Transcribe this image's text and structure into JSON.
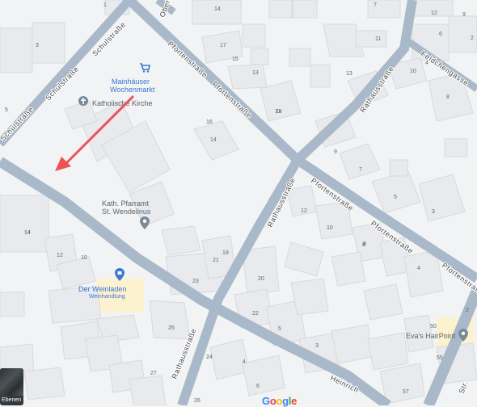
{
  "streets": {
    "schulstrasse_a": "Schulstraße",
    "schulstrasse_b": "Schulstraße",
    "schulstrasse_c": "Schulstraße",
    "pfortenstrasse_a": "Pfortenstraße",
    "pfortenstrasse_b": "Pfortenstraße",
    "pfortenstrasse_c": "Pfortenstraße",
    "pfortenstrasse_d": "Pfortenstraße",
    "pfortenstrasse_e": "Pfortenstraße",
    "pfortenstrasse_f": "Pfortenstraße",
    "rathausstrasse_a": "Rathausstraße",
    "rathausstrasse_b": "Rathausstraße",
    "rathausstrasse_c": "Rathausstraße",
    "feldchengasse": "Feldchengasse",
    "obertor": "Oberto",
    "heinrich": "Heinrich",
    "str_bottom_right": "Str."
  },
  "pois": {
    "mainhaeuser": {
      "line1": "Mainhäuser",
      "line2": "Wochenmarkt",
      "icon": "shopping-cart-icon"
    },
    "kirche": {
      "label": "Katholische Kirche",
      "icon": "cross-icon"
    },
    "pfarramt": {
      "line1": "Kath. Pfarramt",
      "line2": "St. Wendelinus",
      "icon": "place-pin-icon"
    },
    "weinladen": {
      "line1": "Der Weinladen",
      "line2": "Weinhandlung",
      "icon": "shopping-bag-icon"
    },
    "hairpoint": {
      "label": "Eva's HairPoint",
      "icon": "place-pin-icon"
    }
  },
  "house_numbers": [
    "1",
    "3",
    "14",
    "17",
    "15",
    "13",
    "11",
    "16",
    "14",
    "7",
    "12",
    "14",
    "10",
    "4",
    "13",
    "8",
    "14",
    "7",
    "11",
    "12",
    "10",
    "9",
    "6",
    "8",
    "5",
    "3",
    "4",
    "19",
    "21",
    "23",
    "12",
    "14",
    "10",
    "20",
    "22",
    "25",
    "24",
    "27",
    "26",
    "5",
    "3",
    "2",
    "6",
    "4",
    "57",
    "55",
    "50",
    "9",
    "2",
    "5",
    "8"
  ],
  "layers_button": {
    "label": "Ebenen"
  },
  "google_logo": {
    "letters": [
      "G",
      "o",
      "o",
      "g",
      "l",
      "e"
    ],
    "colors": [
      "#4285f4",
      "#ea4335",
      "#fbbc05",
      "#4285f4",
      "#34a853",
      "#ea4335"
    ]
  },
  "annotation_arrow": {
    "color": "#f05252"
  },
  "colors": {
    "road": "#aab9c9",
    "background": "#f1f3f4",
    "building": "#e8eaed",
    "poi_blue": "#3b77d1",
    "poi_highlight": "#fdf2cf"
  }
}
